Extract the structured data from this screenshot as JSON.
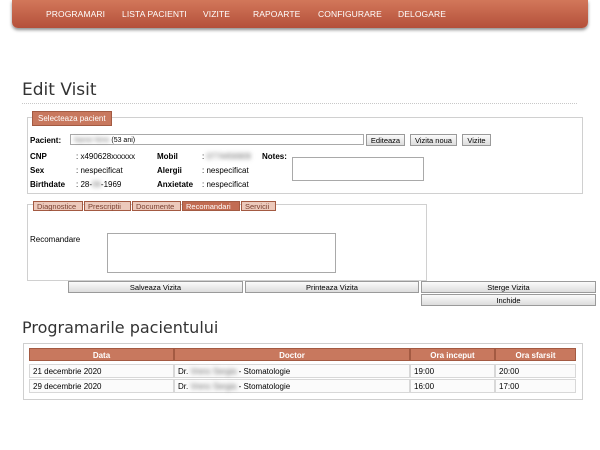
{
  "nav": {
    "items": [
      "PROGRAMARI",
      "LISTA PACIENTI",
      "VIZITE",
      "RAPOARTE",
      "CONFIGURARE",
      "DELOGARE"
    ]
  },
  "page_title": "Edit Visit",
  "patient_section": {
    "legend": "Selecteaza pacient",
    "pacient_label": "Pacient:",
    "pacient_name": "Name Nme",
    "pacient_age": "(53 ani)",
    "buttons": {
      "editeaza": "Editeaza",
      "vizita_noua": "Vizita noua",
      "vizite": "Vizite"
    },
    "cnp_label": "CNP",
    "cnp_value": ": x490628xxxxxx",
    "mobil_label": "Mobil",
    "mobil_value": "0774456909",
    "notes_label": "Notes:",
    "sex_label": "Sex",
    "sex_value": ": nespecificat",
    "alergii_label": "Alergii",
    "alergii_value": ": nespecificat",
    "birthdate_label": "Birthdate",
    "birthdate_prefix": ": 28-",
    "birthdate_month": "06",
    "birthdate_year": "-1969",
    "anxietate_label": "Anxietate",
    "anxietate_value": ": nespecificat"
  },
  "tabs": {
    "items": [
      "Diagnostice",
      "Prescriptii",
      "Documente",
      "Recomandari",
      "Servicii"
    ],
    "active": "Recomandari",
    "recomandare_label": "Recomandare"
  },
  "actions": {
    "salveaza": "Salveaza Vizita",
    "printeaza": "Printeaza Vizita",
    "sterge": "Sterge Vizita",
    "inchide": "Inchide"
  },
  "appointments": {
    "title": "Programarile pacientului",
    "headers": [
      "Data",
      "Doctor",
      "Ora inceput",
      "Ora sfarsit"
    ],
    "rows": [
      {
        "date": "21 decembrie 2020",
        "doctor_prefix": "Dr.",
        "doctor_name": "Vrenc Sergia",
        "specialty": " - Stomatologie",
        "start": "19:00",
        "end": "20:00"
      },
      {
        "date": "29 decembrie 2020",
        "doctor_prefix": "Dr.",
        "doctor_name": "Vrenc Sergia",
        "specialty": " - Stomatologie",
        "start": "16:00",
        "end": "17:00"
      }
    ]
  },
  "colors": {
    "accent": "#c8785e",
    "nav": "#c0604a"
  }
}
